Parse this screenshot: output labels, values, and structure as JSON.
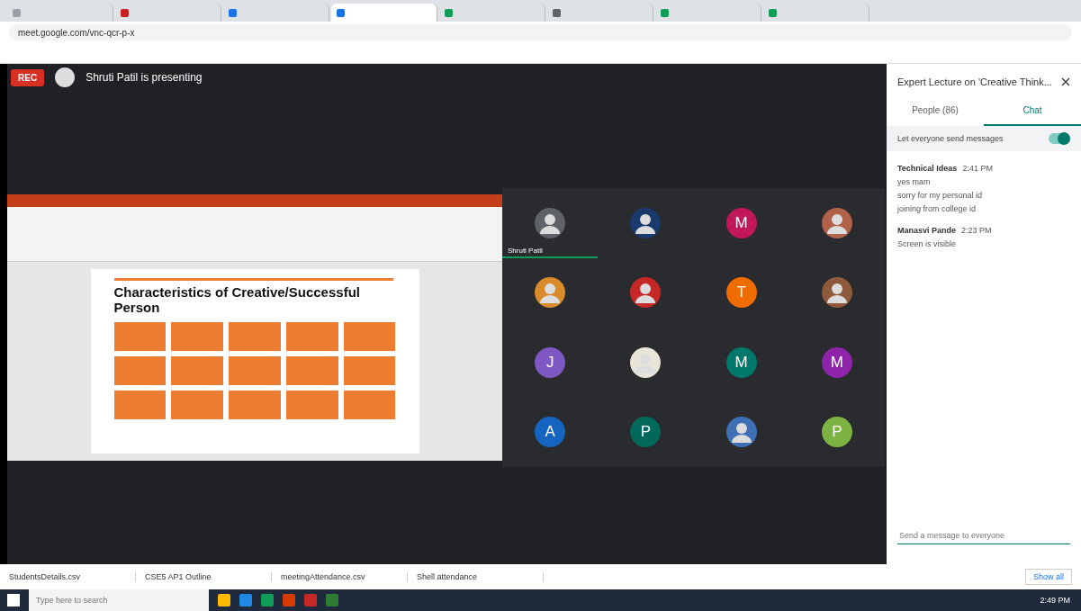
{
  "browser": {
    "tabs": [
      {
        "selected": false,
        "color": "#9aa0a6"
      },
      {
        "selected": false,
        "color": "#c5221f"
      },
      {
        "selected": false,
        "color": "#1a73e8"
      },
      {
        "selected": true,
        "color": "#1a73e8"
      },
      {
        "selected": false,
        "color": "#0f9d58"
      },
      {
        "selected": false,
        "color": "#5f6368"
      },
      {
        "selected": false,
        "color": "#0f9d58"
      },
      {
        "selected": false,
        "color": "#0f9d58"
      }
    ],
    "address": "meet.google.com/vnc-qcr-p-x"
  },
  "meeting": {
    "rec": "REC",
    "presenter": "Shruti Patil is presenting",
    "slide": {
      "title": "Characteristics of Creative/Successful Person"
    },
    "participants": [
      {
        "kind": "avatar",
        "color": "#5f6368",
        "label": "Shruti Patil",
        "presenting": true
      },
      {
        "kind": "avatar",
        "color": "#1a3a6e",
        "presenting": false
      },
      {
        "kind": "letter",
        "letter": "M",
        "color": "#c2185b",
        "presenting": false
      },
      {
        "kind": "avatar",
        "color": "#b0624a",
        "presenting": false
      },
      {
        "kind": "avatar",
        "color": "#d98a2b",
        "presenting": false
      },
      {
        "kind": "avatar",
        "color": "#c62828",
        "presenting": false
      },
      {
        "kind": "letter",
        "letter": "T",
        "color": "#ef6c00",
        "presenting": false
      },
      {
        "kind": "avatar",
        "color": "#8d5a3b",
        "presenting": false
      },
      {
        "kind": "letter",
        "letter": "J",
        "color": "#7e57c2",
        "presenting": false
      },
      {
        "kind": "avatar",
        "color": "#e8e4d8",
        "presenting": false
      },
      {
        "kind": "letter",
        "letter": "M",
        "color": "#00796b",
        "presenting": false
      },
      {
        "kind": "letter",
        "letter": "M",
        "color": "#8e24aa",
        "presenting": false
      },
      {
        "kind": "letter",
        "letter": "A",
        "color": "#1565c0",
        "presenting": false
      },
      {
        "kind": "letter",
        "letter": "P",
        "color": "#00695c",
        "presenting": false
      },
      {
        "kind": "avatar",
        "color": "#3f6fb5",
        "presenting": false
      },
      {
        "kind": "letter",
        "letter": "P",
        "color": "#7cb342",
        "presenting": false
      }
    ]
  },
  "chat_panel": {
    "title": "Expert Lecture on 'Creative Think...",
    "tabs": [
      {
        "label": "People (86)",
        "selected": false
      },
      {
        "label": "Chat",
        "selected": true
      }
    ],
    "setting": {
      "label": "Let everyone send messages",
      "on": true
    },
    "messages": [
      {
        "sender": "Technical Ideas",
        "time": "2:41 PM",
        "lines": [
          "yes mam",
          "sorry for my personal id",
          "joining from college id"
        ]
      },
      {
        "sender": "Manasvi Pande",
        "time": "2:23 PM",
        "lines": [
          "Screen is visible"
        ]
      }
    ],
    "input": {
      "placeholder": "Send a message to everyone"
    }
  },
  "downloads": {
    "items": [
      "StudentsDetails.csv",
      "CSE5 AP1 Outline",
      "meetingAttendance.csv",
      "Shell attendance"
    ],
    "show_all": "Show all"
  },
  "taskbar": {
    "search_placeholder": "Type here to search",
    "time": "2:49 PM"
  }
}
